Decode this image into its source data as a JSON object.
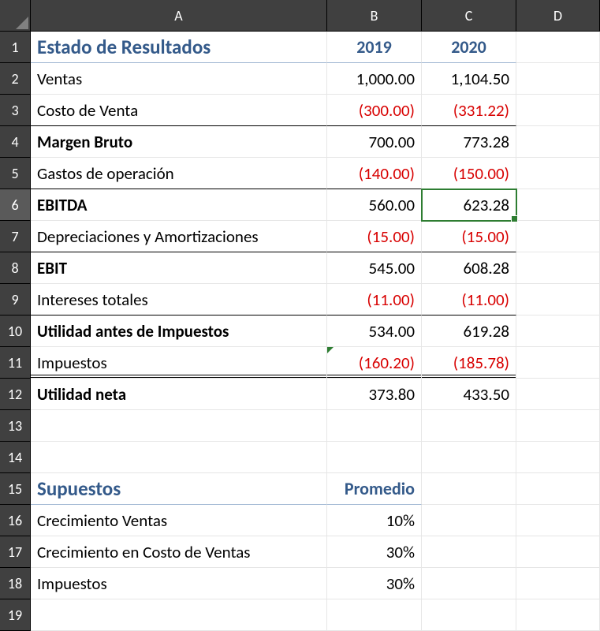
{
  "columns": {
    "A": "A",
    "B": "B",
    "C": "C",
    "D": "D"
  },
  "rows": [
    "1",
    "2",
    "3",
    "4",
    "5",
    "6",
    "7",
    "8",
    "9",
    "10",
    "11",
    "12",
    "13",
    "14",
    "15",
    "16",
    "17",
    "18",
    "19"
  ],
  "section1": {
    "title": "Estado de Resultados",
    "year1": "2019",
    "year2": "2020"
  },
  "lines": {
    "ventas": {
      "label": "Ventas",
      "y1": "1,000.00",
      "y2": "1,104.50"
    },
    "costo": {
      "label": "Costo de Venta",
      "y1": "(300.00)",
      "y2": "(331.22)"
    },
    "margen": {
      "label": "Margen Bruto",
      "y1": "700.00",
      "y2": "773.28"
    },
    "gastos": {
      "label": "Gastos de operación",
      "y1": "(140.00)",
      "y2": "(150.00)"
    },
    "ebitda": {
      "label": "EBITDA",
      "y1": "560.00",
      "y2": "623.28"
    },
    "dep": {
      "label": "Depreciaciones y Amortizaciones",
      "y1": "(15.00)",
      "y2": "(15.00)"
    },
    "ebit": {
      "label": "EBIT",
      "y1": "545.00",
      "y2": "608.28"
    },
    "intereses": {
      "label": "Intereses totales",
      "y1": "(11.00)",
      "y2": "(11.00)"
    },
    "uai": {
      "label": "Utilidad antes de Impuestos",
      "y1": "534.00",
      "y2": "619.28"
    },
    "impuestos": {
      "label": "Impuestos",
      "y1": "(160.20)",
      "y2": "(185.78)"
    },
    "neta": {
      "label": "Utilidad neta",
      "y1": "373.80",
      "y2": "433.50"
    }
  },
  "section2": {
    "title": "Supuestos",
    "colhdr": "Promedio",
    "items": {
      "crec_ventas": {
        "label": "Crecimiento Ventas",
        "val": "10%"
      },
      "crec_costo": {
        "label": "Crecimiento en Costo de Ventas",
        "val": "30%"
      },
      "imp": {
        "label": "Impuestos",
        "val": "30%"
      }
    }
  },
  "chart_data": [
    {
      "type": "table",
      "title": "Estado de Resultados",
      "categories": [
        "2019",
        "2020"
      ],
      "series": [
        {
          "name": "Ventas",
          "values": [
            1000.0,
            1104.5
          ]
        },
        {
          "name": "Costo de Venta",
          "values": [
            -300.0,
            -331.22
          ]
        },
        {
          "name": "Margen Bruto",
          "values": [
            700.0,
            773.28
          ]
        },
        {
          "name": "Gastos de operación",
          "values": [
            -140.0,
            -150.0
          ]
        },
        {
          "name": "EBITDA",
          "values": [
            560.0,
            623.28
          ]
        },
        {
          "name": "Depreciaciones y Amortizaciones",
          "values": [
            -15.0,
            -15.0
          ]
        },
        {
          "name": "EBIT",
          "values": [
            545.0,
            608.28
          ]
        },
        {
          "name": "Intereses totales",
          "values": [
            -11.0,
            -11.0
          ]
        },
        {
          "name": "Utilidad antes de Impuestos",
          "values": [
            534.0,
            619.28
          ]
        },
        {
          "name": "Impuestos",
          "values": [
            -160.2,
            -185.78
          ]
        },
        {
          "name": "Utilidad neta",
          "values": [
            373.8,
            433.5
          ]
        }
      ]
    },
    {
      "type": "table",
      "title": "Supuestos",
      "categories": [
        "Promedio"
      ],
      "series": [
        {
          "name": "Crecimiento Ventas",
          "values": [
            0.1
          ]
        },
        {
          "name": "Crecimiento en Costo de Ventas",
          "values": [
            0.3
          ]
        },
        {
          "name": "Impuestos",
          "values": [
            0.3
          ]
        }
      ]
    }
  ]
}
